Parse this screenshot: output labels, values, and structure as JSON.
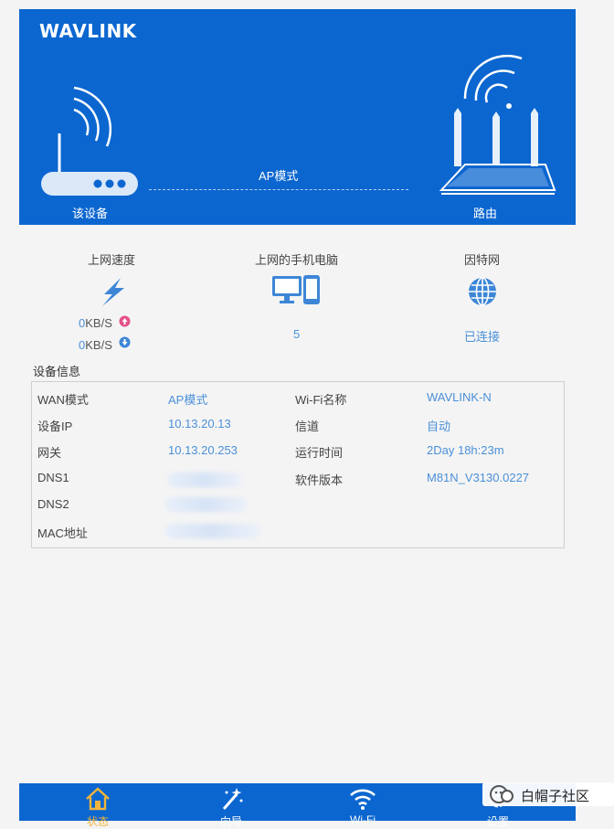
{
  "brand": {
    "logo": "WAVLINK"
  },
  "hero": {
    "device_label": "该设备",
    "mode_label": "AP模式",
    "router_label": "路由"
  },
  "stats": {
    "speed": {
      "title": "上网速度",
      "up": "0",
      "down": "0",
      "unit": "KB/S"
    },
    "clients": {
      "title": "上网的手机电脑",
      "value": "5"
    },
    "internet": {
      "title": "因特网",
      "value": "已连接"
    }
  },
  "device_info": {
    "title": "设备信息",
    "rows": [
      {
        "k1": "WAN模式",
        "v1": "AP模式",
        "k2": "Wi-Fi名称",
        "v2": "WAVLINK-N"
      },
      {
        "k1": "设备IP",
        "v1": "10.13.20.13",
        "k2": "信道",
        "v2": "自动"
      },
      {
        "k1": "网关",
        "v1": "10.13.20.253",
        "k2": "运行时间",
        "v2": "2Day 18h:23m"
      },
      {
        "k1": "DNS1",
        "v1": "",
        "k2": "软件版本",
        "v2": "M81N_V3130.0227"
      },
      {
        "k1": "DNS2",
        "v1": "",
        "k2": "",
        "v2": ""
      },
      {
        "k1": "MAC地址",
        "v1": "",
        "k2": "",
        "v2": ""
      }
    ]
  },
  "bottom_nav": {
    "items": [
      {
        "label": "状态",
        "icon": "home-icon",
        "active": true
      },
      {
        "label": "向导",
        "icon": "magic-wand-icon",
        "active": false
      },
      {
        "label": "Wi-Fi",
        "icon": "wifi-icon",
        "active": false
      },
      {
        "label": "设置",
        "icon": "gear-icon",
        "active": false
      }
    ]
  },
  "watermark": {
    "text": "白帽子社区"
  },
  "colors": {
    "brand_blue": "#0b66d0",
    "value_blue": "#4a90d9",
    "active_nav": "#f2b53b"
  }
}
